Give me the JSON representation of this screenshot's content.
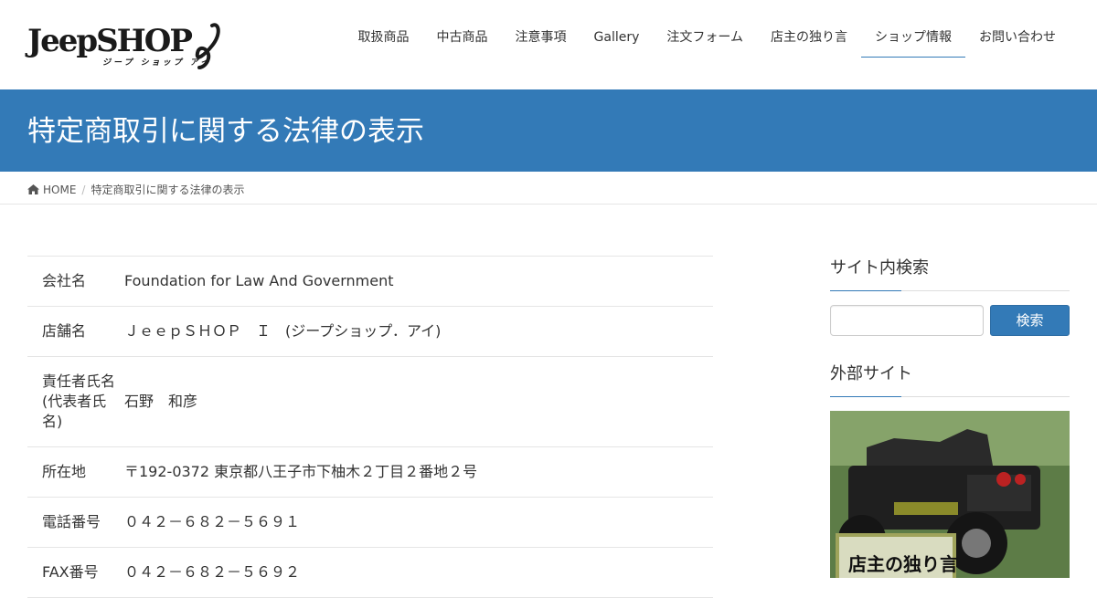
{
  "header": {
    "logo_text": "JeepSHOP",
    "logo_kana": "ジープ ショップ アイ",
    "nav": [
      {
        "label": "取扱商品",
        "active": false
      },
      {
        "label": "中古商品",
        "active": false
      },
      {
        "label": "注意事項",
        "active": false
      },
      {
        "label": "Gallery",
        "active": false
      },
      {
        "label": "注文フォーム",
        "active": false
      },
      {
        "label": "店主の独り言",
        "active": false
      },
      {
        "label": "ショップ情報",
        "active": true
      },
      {
        "label": "お問い合わせ",
        "active": false
      }
    ]
  },
  "page_title": "特定商取引に関する法律の表示",
  "breadcrumb": {
    "home_label": "HOME",
    "current": "特定商取引に関する法律の表示"
  },
  "info_table": [
    {
      "label": "会社名",
      "value": "Foundation for Law And Government"
    },
    {
      "label": "店舗名",
      "value": "ＪｅｅｐＳＨＯＰ　Ｉ　(ジープショップ．アイ)"
    },
    {
      "label": "責任者氏名(代表者氏名)",
      "value": "石野　和彦"
    },
    {
      "label": "所在地",
      "value": "〒192-0372 東京都八王子市下柚木２丁目２番地２号"
    },
    {
      "label": "電話番号",
      "value": "０４２－６８２－５６９１"
    },
    {
      "label": "FAX番号",
      "value": "０４２－６８２－５６９２"
    }
  ],
  "sidebar": {
    "search_heading": "サイト内検索",
    "search_value": "",
    "search_button": "検索",
    "external_heading": "外部サイト",
    "banner_text": "店主の独り言"
  },
  "colors": {
    "accent": "#337ab7",
    "text": "#333333",
    "border": "#e5e5e5"
  }
}
